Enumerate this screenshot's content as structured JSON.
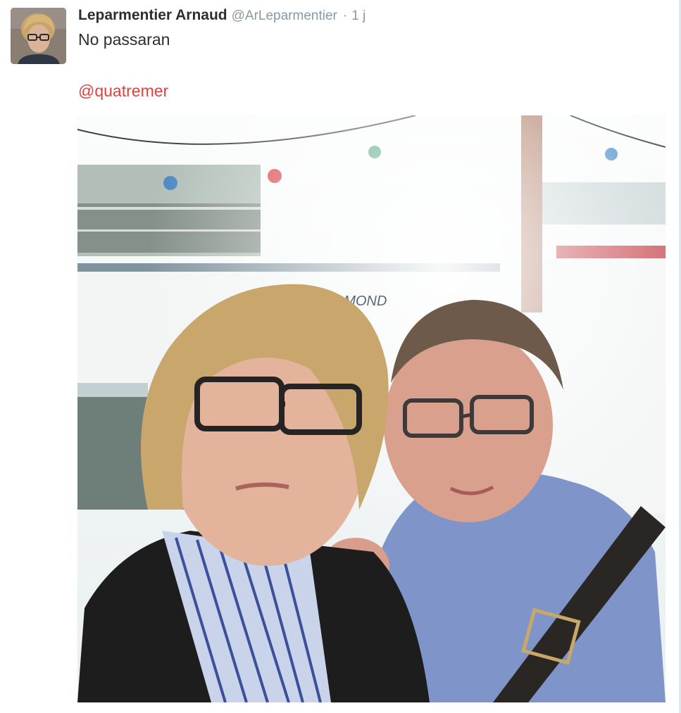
{
  "tweet": {
    "author_name": "Leparmentier Arnaud",
    "author_handle": "@ArLeparmentier",
    "separator": "·",
    "time": "1 j",
    "text": "No passaran",
    "mention": "@quatremer",
    "avatar_icon": "profile-photo",
    "media_overlay_text": "AMOND",
    "colors": {
      "mention": "#e0413c",
      "name": "#292f33",
      "meta": "#8899a6"
    }
  }
}
